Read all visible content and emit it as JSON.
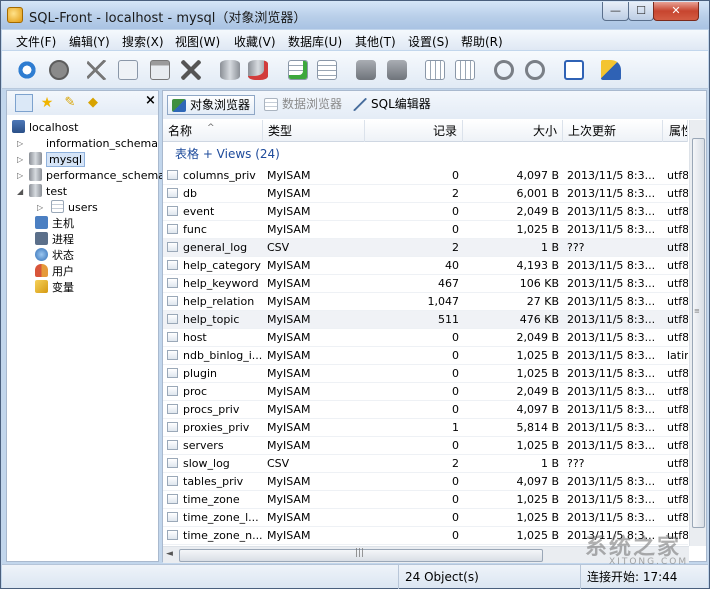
{
  "window": {
    "title": "SQL-Front - localhost - mysql（对象浏览器）",
    "min": "0",
    "max": "1",
    "close": "r"
  },
  "menu": [
    "文件(F)",
    "编辑(Y)",
    "搜索(X)",
    "视图(W)",
    "收藏(V)",
    "数据库(U)",
    "其他(T)",
    "设置(S)",
    "帮助(R)"
  ],
  "toolbar_icons": [
    "refresh-icon",
    "stop-icon",
    "cut-icon",
    "copy-icon",
    "paste-icon",
    "delete-icon",
    "new-database-icon",
    "drop-database-icon",
    "new-table-icon",
    "drop-table-icon",
    "new-field-icon",
    "drop-field-icon",
    "new-index-icon",
    "drop-index-icon",
    "new-link-icon",
    "drop-link-icon",
    "checklist-icon",
    "clean-icon"
  ],
  "sidebar": {
    "close": "×",
    "tools": [
      "tree-icon",
      "favorite-icon",
      "connect-icon",
      "key-icon"
    ],
    "tree": {
      "server": "localhost",
      "databases": [
        "information_schema",
        "mysql",
        "performance_schema",
        "test"
      ],
      "test_tables": [
        "users"
      ],
      "extras": [
        "主机",
        "进程",
        "状态",
        "用户",
        "变量"
      ]
    }
  },
  "tabs": {
    "objects": "对象浏览器",
    "data": "数据浏览器",
    "sql": "SQL编辑器"
  },
  "grid": {
    "columns": {
      "name": "名称",
      "type": "类型",
      "records": "记录",
      "size": "大小",
      "updated": "上次更新",
      "attr": "属性"
    },
    "sort_arrow": "^",
    "group": "表格 + Views (24)",
    "rows": [
      {
        "name": "columns_priv",
        "type": "MyISAM",
        "records": "0",
        "size": "4,097 B",
        "updated": "2013/11/5 8:3...",
        "attr": "utf8"
      },
      {
        "name": "db",
        "type": "MyISAM",
        "records": "2",
        "size": "6,001 B",
        "updated": "2013/11/5 8:3...",
        "attr": "utf8"
      },
      {
        "name": "event",
        "type": "MyISAM",
        "records": "0",
        "size": "2,049 B",
        "updated": "2013/11/5 8:3...",
        "attr": "utf8"
      },
      {
        "name": "func",
        "type": "MyISAM",
        "records": "0",
        "size": "1,025 B",
        "updated": "2013/11/5 8:3...",
        "attr": "utf8"
      },
      {
        "name": "general_log",
        "type": "CSV",
        "records": "2",
        "size": "1 B",
        "updated": "???",
        "attr": "utf8"
      },
      {
        "name": "help_category",
        "type": "MyISAM",
        "records": "40",
        "size": "4,193 B",
        "updated": "2013/11/5 8:3...",
        "attr": "utf8"
      },
      {
        "name": "help_keyword",
        "type": "MyISAM",
        "records": "467",
        "size": "106 KB",
        "updated": "2013/11/5 8:3...",
        "attr": "utf8"
      },
      {
        "name": "help_relation",
        "type": "MyISAM",
        "records": "1,047",
        "size": "27 KB",
        "updated": "2013/11/5 8:3...",
        "attr": "utf8"
      },
      {
        "name": "help_topic",
        "type": "MyISAM",
        "records": "511",
        "size": "476 KB",
        "updated": "2013/11/5 8:3...",
        "attr": "utf8"
      },
      {
        "name": "host",
        "type": "MyISAM",
        "records": "0",
        "size": "2,049 B",
        "updated": "2013/11/5 8:3...",
        "attr": "utf8"
      },
      {
        "name": "ndb_binlog_i...",
        "type": "MyISAM",
        "records": "0",
        "size": "1,025 B",
        "updated": "2013/11/5 8:3...",
        "attr": "latin"
      },
      {
        "name": "plugin",
        "type": "MyISAM",
        "records": "0",
        "size": "1,025 B",
        "updated": "2013/11/5 8:3...",
        "attr": "utf8"
      },
      {
        "name": "proc",
        "type": "MyISAM",
        "records": "0",
        "size": "2,049 B",
        "updated": "2013/11/5 8:3...",
        "attr": "utf8"
      },
      {
        "name": "procs_priv",
        "type": "MyISAM",
        "records": "0",
        "size": "4,097 B",
        "updated": "2013/11/5 8:3...",
        "attr": "utf8"
      },
      {
        "name": "proxies_priv",
        "type": "MyISAM",
        "records": "1",
        "size": "5,814 B",
        "updated": "2013/11/5 8:3...",
        "attr": "utf8"
      },
      {
        "name": "servers",
        "type": "MyISAM",
        "records": "0",
        "size": "1,025 B",
        "updated": "2013/11/5 8:3...",
        "attr": "utf8"
      },
      {
        "name": "slow_log",
        "type": "CSV",
        "records": "2",
        "size": "1 B",
        "updated": "???",
        "attr": "utf8"
      },
      {
        "name": "tables_priv",
        "type": "MyISAM",
        "records": "0",
        "size": "4,097 B",
        "updated": "2013/11/5 8:3...",
        "attr": "utf8"
      },
      {
        "name": "time_zone",
        "type": "MyISAM",
        "records": "0",
        "size": "1,025 B",
        "updated": "2013/11/5 8:3...",
        "attr": "utf8"
      },
      {
        "name": "time_zone_l...",
        "type": "MyISAM",
        "records": "0",
        "size": "1,025 B",
        "updated": "2013/11/5 8:3...",
        "attr": "utf8"
      },
      {
        "name": "time_zone_n...",
        "type": "MyISAM",
        "records": "0",
        "size": "1,025 B",
        "updated": "2013/11/5 8:3...",
        "attr": "utf8"
      }
    ]
  },
  "scroll": {
    "h_grip": "|||",
    "v_grip": "≡",
    "left": "◄"
  },
  "status": {
    "objects": "24 Object(s)",
    "connect": "连接开始: 17:44"
  },
  "watermark": {
    "text": "系统之家",
    "url": "XITONG.COM"
  }
}
